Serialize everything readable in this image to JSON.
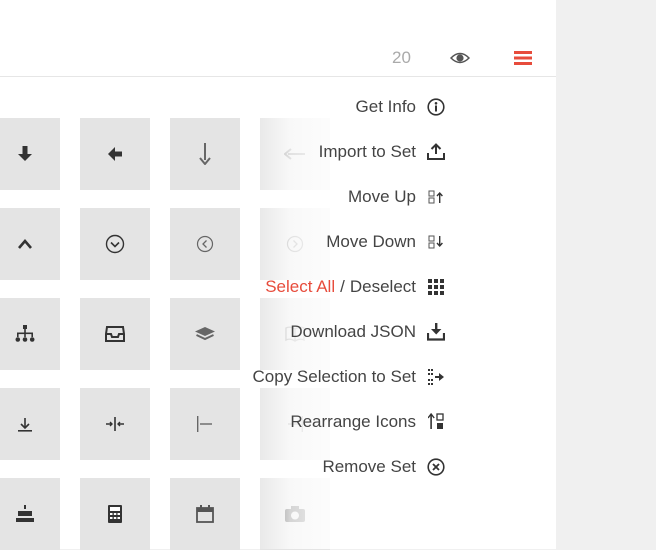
{
  "toolbar": {
    "count": "20",
    "eye_icon": "eye-icon",
    "menu_icon": "hamburger-menu-icon",
    "accent": "#e74c3c"
  },
  "menu": {
    "get_info": "Get Info",
    "import_to_set": "Import to Set",
    "move_up": "Move Up",
    "move_down": "Move Down",
    "select_all": "Select All",
    "separator": "/",
    "deselect": "Deselect",
    "download_json": "Download JSON",
    "copy_selection": "Copy Selection to Set",
    "rearrange_icons": "Rearrange Icons",
    "remove_set": "Remove Set"
  },
  "grid_icons": [
    "arrow-down-icon",
    "arrow-left-icon",
    "long-arrow-down-icon",
    "long-arrow-left-icon",
    "chevron-up-icon",
    "circle-chevron-down-icon",
    "circle-chevron-left-icon",
    "circle-chevron-right-icon",
    "sitemap-icon",
    "inbox-icon",
    "layers-icon",
    "book-icon",
    "align-bottom-icon",
    "align-center-horizontal-icon",
    "align-left-icon",
    "align-right-icon",
    "birthday-cake-icon",
    "calculator-icon",
    "calendar-icon",
    "camera-icon"
  ]
}
